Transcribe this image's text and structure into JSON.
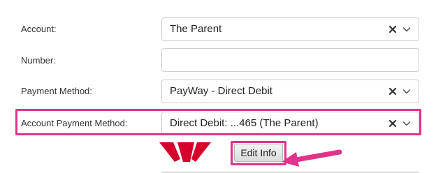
{
  "form": {
    "account": {
      "label": "Account:",
      "value": "The Parent"
    },
    "number": {
      "label": "Number:",
      "value": ""
    },
    "payment_method": {
      "label": "Payment Method:",
      "value": "PayWay - Direct Debit"
    },
    "account_payment_method": {
      "label": "Account Payment Method:",
      "value": "Direct Debit: ...465 (The Parent)"
    },
    "edit_info_label": "Edit Info"
  },
  "icons": {
    "clear": "clear-x-icon",
    "dropdown": "chevron-down-icon",
    "bank_logo": "westpac-logo-icon",
    "arrow": "annotation-arrow-icon"
  },
  "colors": {
    "highlight": "#e0338a",
    "logo_red": "#d5002b"
  }
}
